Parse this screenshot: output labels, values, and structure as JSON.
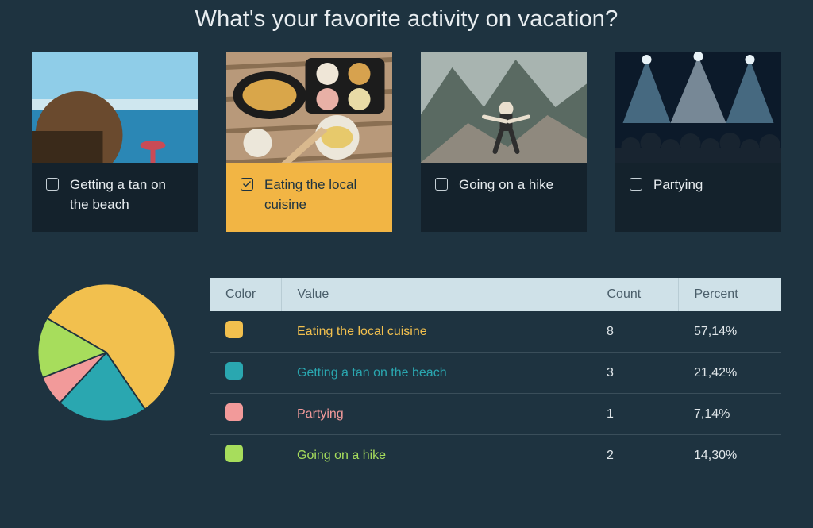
{
  "question": "What's your favorite activity on vacation?",
  "options": [
    {
      "label": "Getting a tan on the beach",
      "selected": false,
      "image": "beach"
    },
    {
      "label": "Eating the local cuisine",
      "selected": true,
      "image": "food"
    },
    {
      "label": "Going on a hike",
      "selected": false,
      "image": "hike"
    },
    {
      "label": "Partying",
      "selected": false,
      "image": "party"
    }
  ],
  "table": {
    "headers": {
      "color": "Color",
      "value": "Value",
      "count": "Count",
      "percent": "Percent"
    },
    "rows": [
      {
        "label": "Eating the local cuisine",
        "count": "8",
        "percent": "57,14%",
        "color": "#f2c04e"
      },
      {
        "label": "Getting a tan on the beach",
        "count": "3",
        "percent": "21,42%",
        "color": "#2aa7b0"
      },
      {
        "label": "Partying",
        "count": "1",
        "percent": "7,14%",
        "color": "#f29a9a"
      },
      {
        "label": "Going on a hike",
        "count": "2",
        "percent": "14,30%",
        "color": "#a7dd5c"
      }
    ]
  },
  "chart_data": {
    "type": "pie",
    "title": "What's your favorite activity on vacation?",
    "series": [
      {
        "name": "Eating the local cuisine",
        "value": 57.14,
        "count": 8,
        "color": "#f2c04e"
      },
      {
        "name": "Getting a tan on the beach",
        "value": 21.42,
        "count": 3,
        "color": "#2aa7b0"
      },
      {
        "name": "Partying",
        "value": 7.14,
        "count": 1,
        "color": "#f29a9a"
      },
      {
        "name": "Going on a hike",
        "value": 14.3,
        "count": 2,
        "color": "#a7dd5c"
      }
    ]
  }
}
